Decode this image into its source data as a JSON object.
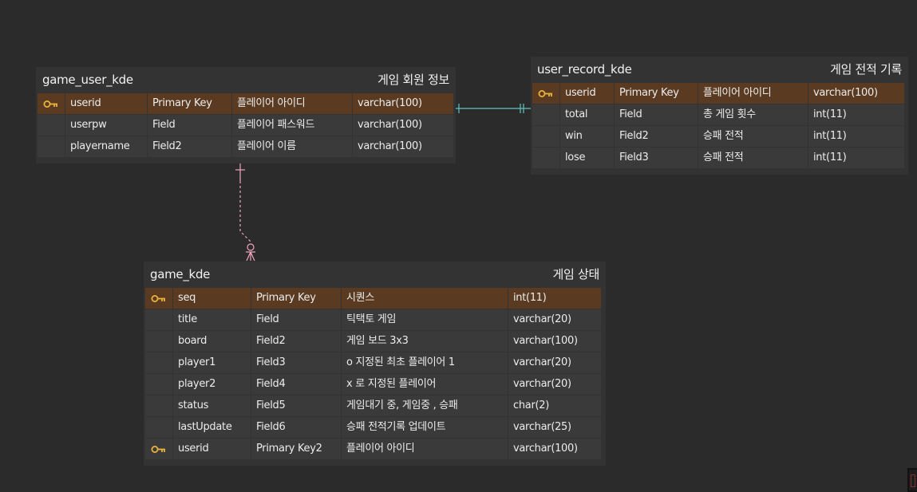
{
  "tables": [
    {
      "name": "game_user_kde",
      "comment": "게임 회원 정보",
      "rows": [
        {
          "key": true,
          "field": "userid",
          "type": "Primary Key",
          "desc": "플레이어 아이디",
          "dtype": "varchar(100)"
        },
        {
          "key": false,
          "field": "userpw",
          "type": "Field",
          "desc": "플레이어 패스워드",
          "dtype": "varchar(100)"
        },
        {
          "key": false,
          "field": "playername",
          "type": "Field2",
          "desc": "플레이어 이름",
          "dtype": "varchar(100)"
        }
      ]
    },
    {
      "name": "user_record_kde",
      "comment": "게임 전적 기록",
      "rows": [
        {
          "key": true,
          "field": "userid",
          "type": "Primary Key",
          "desc": "플레이어 아이디",
          "dtype": "varchar(100)"
        },
        {
          "key": false,
          "field": "total",
          "type": "Field",
          "desc": "총 게임 횟수",
          "dtype": "int(11)"
        },
        {
          "key": false,
          "field": "win",
          "type": "Field2",
          "desc": "승패 전적",
          "dtype": "int(11)"
        },
        {
          "key": false,
          "field": "lose",
          "type": "Field3",
          "desc": "승패 전적",
          "dtype": "int(11)"
        }
      ]
    },
    {
      "name": "game_kde",
      "comment": "게임 상태",
      "rows": [
        {
          "key": true,
          "field": "seq",
          "type": "Primary Key",
          "desc": "시퀀스",
          "dtype": "int(11)"
        },
        {
          "key": false,
          "field": "title",
          "type": "Field",
          "desc": "틱택토 게임",
          "dtype": "varchar(20)"
        },
        {
          "key": false,
          "field": "board",
          "type": "Field2",
          "desc": "게임 보드 3x3",
          "dtype": "varchar(100)"
        },
        {
          "key": false,
          "field": "player1",
          "type": "Field3",
          "desc": "o 지정된 최초 플레이어 1",
          "dtype": "varchar(20)"
        },
        {
          "key": false,
          "field": "player2",
          "type": "Field4",
          "desc": "x 로 지정된 플레이어",
          "dtype": "varchar(20)"
        },
        {
          "key": false,
          "field": "status",
          "type": "Field5",
          "desc": "게임대기 중, 게임중 , 승패",
          "dtype": "char(2)"
        },
        {
          "key": false,
          "field": "lastUpdate",
          "type": "Field6",
          "desc": "승패 전적기록 업데이트",
          "dtype": "varchar(25)"
        },
        {
          "key": true,
          "field": "userid",
          "type": "Primary Key2",
          "desc": "플레이어 아이디",
          "dtype": "varchar(100)"
        }
      ]
    }
  ],
  "colors": {
    "background": "#2b2b2b",
    "table": "#333333",
    "cell": "#3a3a3a",
    "pk_row": "#5a3b22",
    "key_icon": "#e8b23c",
    "rel_one_to_one": "#5fc4c4",
    "rel_one_to_many": "#f0a6bd"
  }
}
